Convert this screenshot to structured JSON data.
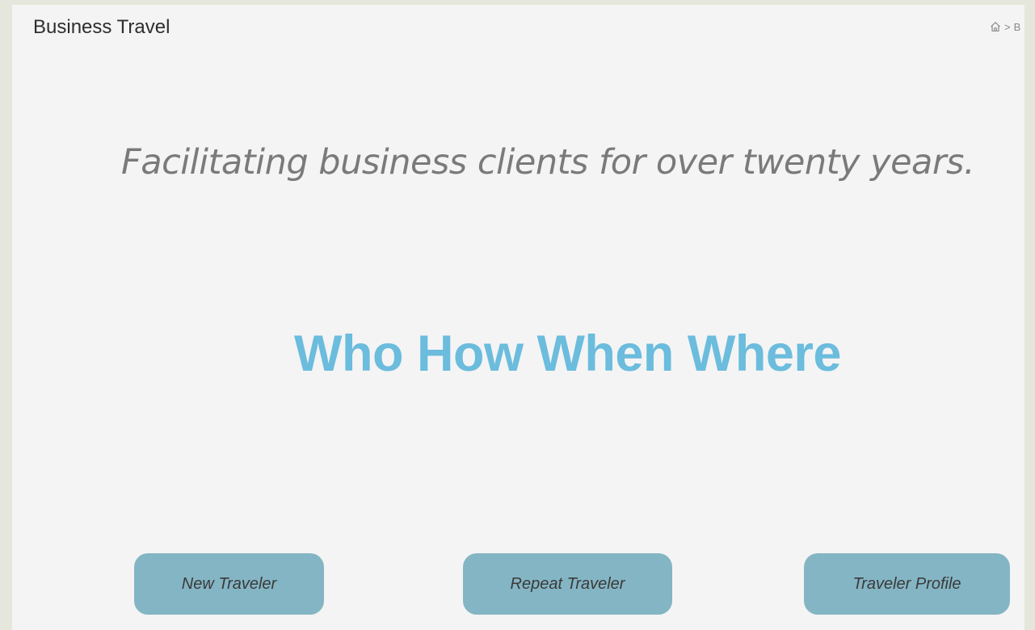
{
  "header": {
    "title": "Business Travel"
  },
  "breadcrumb": {
    "home_icon": "home-icon",
    "separator": ">",
    "current": "B"
  },
  "hero": {
    "tagline": "Facilitating business clients for over twenty years.",
    "headline": "Who How When Where"
  },
  "actions": {
    "new_traveler": "New Traveler",
    "repeat_traveler": "Repeat Traveler",
    "traveler_profile": "Traveler Profile"
  },
  "colors": {
    "background": "#e6e7dc",
    "panel": "#f4f4f4",
    "headline": "#6bbcdd",
    "button": "#84b5c4"
  }
}
